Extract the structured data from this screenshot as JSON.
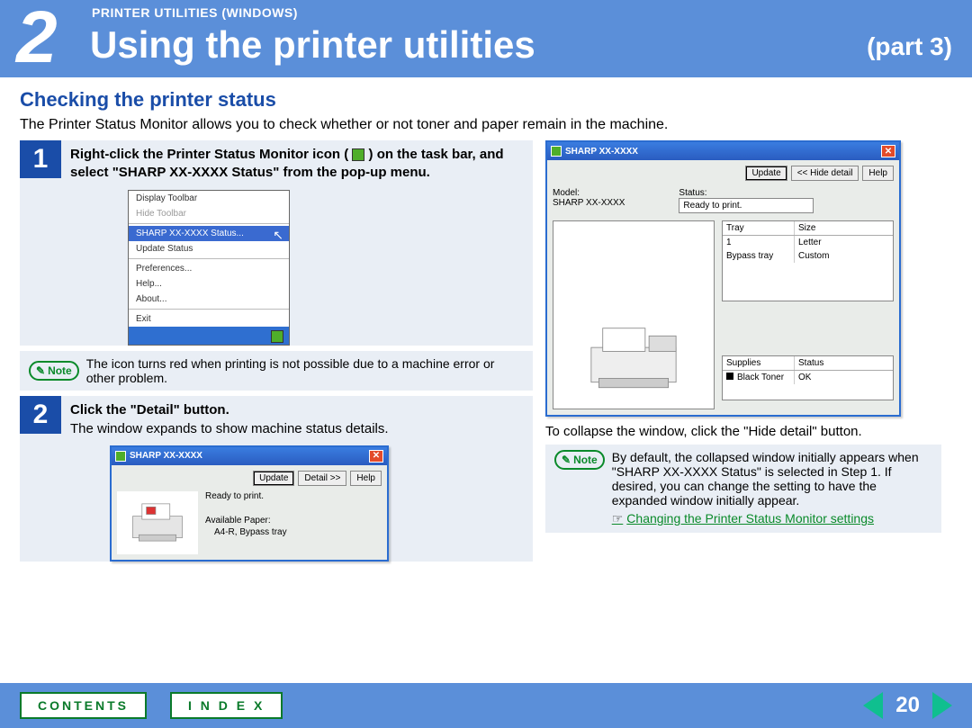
{
  "header": {
    "chapter_num": "2",
    "breadcrumb": "PRINTER UTILITIES (WINDOWS)",
    "title": "Using the printer utilities",
    "part": "(part 3)"
  },
  "subtitle": "Checking the printer status",
  "intro": "The Printer Status Monitor allows you to check whether or not toner and paper remain in the machine.",
  "step1": {
    "num": "1",
    "title_a": "Right-click the Printer Status Monitor icon (",
    "title_b": ") on the task bar, and select \"SHARP XX-XXXX Status\" from the pop-up menu.",
    "menu": {
      "items": [
        "Display Toolbar",
        "Hide Toolbar",
        "SHARP XX-XXXX Status...",
        "Update Status",
        "Preferences...",
        "Help...",
        "About...",
        "Exit"
      ]
    }
  },
  "note1": {
    "label": "Note",
    "text": "The icon turns red when printing is not possible due to a machine error or other problem."
  },
  "step2": {
    "num": "2",
    "title": "Click the \"Detail\" button.",
    "desc": "The window expands to show machine status details."
  },
  "win_small": {
    "title": "SHARP XX-XXXX",
    "btn_update": "Update",
    "btn_detail": "Detail >>",
    "btn_help": "Help",
    "ready": "Ready to print.",
    "avail_label": "Available Paper:",
    "avail_value": "A4-R, Bypass tray"
  },
  "win_big": {
    "title": "SHARP XX-XXXX",
    "btn_update": "Update",
    "btn_hide": "<< Hide detail",
    "btn_help": "Help",
    "model_label": "Model:",
    "model_value": "SHARP XX-XXXX",
    "status_label": "Status:",
    "status_value": "Ready to print.",
    "tray_header_1": "Tray",
    "tray_header_2": "Size",
    "tray_rows": [
      {
        "tray": "1",
        "size": "Letter"
      },
      {
        "tray": "Bypass tray",
        "size": "Custom"
      }
    ],
    "sup_header_1": "Supplies",
    "sup_header_2": "Status",
    "sup_rows": [
      {
        "name": "Black Toner",
        "status": "OK"
      }
    ]
  },
  "right_caption": "To collapse the window, click the \"Hide detail\" button.",
  "note2": {
    "label": "Note",
    "text": "By default, the collapsed window initially appears when \"SHARP XX-XXXX Status\" is selected in Step 1. If desired, you can change the setting to have the expanded window initially appear.",
    "link": "Changing the Printer Status Monitor settings"
  },
  "footer": {
    "contents": "CONTENTS",
    "index": "I N D E X",
    "page": "20"
  }
}
